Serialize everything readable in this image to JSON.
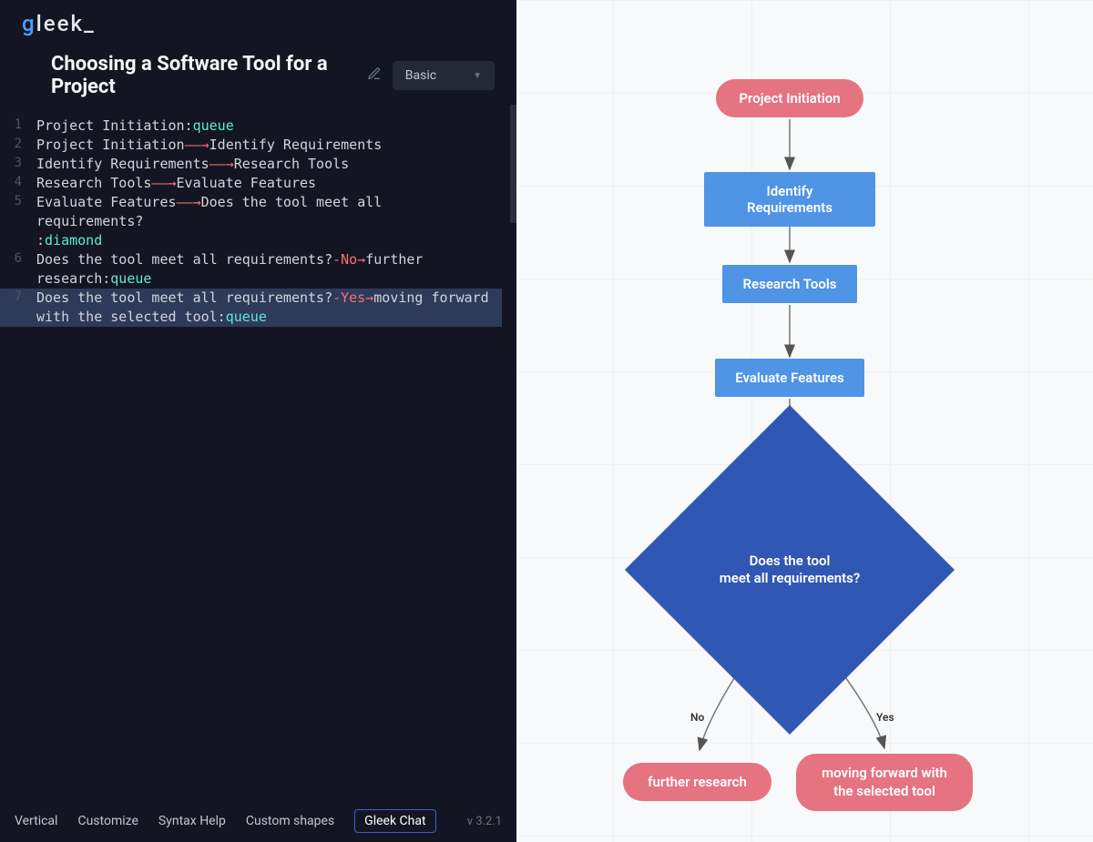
{
  "app": {
    "logo_g": "g",
    "logo_text": "leek_"
  },
  "header": {
    "title": "Choosing a Software Tool for a Project",
    "diagram_type": "Basic"
  },
  "code": {
    "lines": [
      {
        "num": "1",
        "tokens": [
          {
            "t": "text",
            "v": "Project Initiation:"
          },
          {
            "t": "queue",
            "v": "queue"
          }
        ]
      },
      {
        "num": "2",
        "tokens": [
          {
            "t": "text",
            "v": "Project Initiation"
          },
          {
            "t": "arrow",
            "v": "——→"
          },
          {
            "t": "text",
            "v": "Identify Requirements"
          }
        ]
      },
      {
        "num": "3",
        "tokens": [
          {
            "t": "text",
            "v": "Identify Requirements"
          },
          {
            "t": "arrow",
            "v": "——→"
          },
          {
            "t": "text",
            "v": "Research Tools"
          }
        ]
      },
      {
        "num": "4",
        "tokens": [
          {
            "t": "text",
            "v": "Research Tools"
          },
          {
            "t": "arrow",
            "v": "——→"
          },
          {
            "t": "text",
            "v": "Evaluate Features"
          }
        ]
      },
      {
        "num": "5",
        "tokens": [
          {
            "t": "text",
            "v": "Evaluate Features"
          },
          {
            "t": "arrow",
            "v": "——→"
          },
          {
            "t": "text",
            "v": "Does the tool meet all requirements?\n:"
          },
          {
            "t": "diamond",
            "v": "diamond"
          }
        ]
      },
      {
        "num": "6",
        "tokens": [
          {
            "t": "text",
            "v": "Does the tool meet all requirements?"
          },
          {
            "t": "branch",
            "v": "-No→"
          },
          {
            "t": "text",
            "v": "further research:"
          },
          {
            "t": "queue",
            "v": "queue"
          }
        ]
      },
      {
        "num": "7",
        "highlight": true,
        "tokens": [
          {
            "t": "text",
            "v": "Does the tool meet all requirements?"
          },
          {
            "t": "branch",
            "v": "-Yes→"
          },
          {
            "t": "text",
            "v": "moving forward with the selected tool:"
          },
          {
            "t": "queue",
            "v": "queue"
          }
        ]
      }
    ]
  },
  "bottom": {
    "vertical": "Vertical",
    "customize": "Customize",
    "syntax_help": "Syntax Help",
    "custom_shapes": "Custom shapes",
    "gleek_chat": "Gleek Chat",
    "version": "v 3.2.1"
  },
  "flow": {
    "nodes": {
      "start": "Project Initiation",
      "identify": "Identify Requirements",
      "research": "Research Tools",
      "evaluate": "Evaluate Features",
      "decision_l1": "Does the tool",
      "decision_l2": "meet all requirements?",
      "no_label": "No",
      "yes_label": "Yes",
      "further": "further research",
      "forward_l1": "moving forward with",
      "forward_l2": "the selected tool"
    }
  },
  "chart_data": {
    "type": "flowchart",
    "direction": "TB",
    "nodes": [
      {
        "id": "start",
        "label": "Project Initiation",
        "shape": "queue",
        "color": "#e57380"
      },
      {
        "id": "identify",
        "label": "Identify Requirements",
        "shape": "rect",
        "color": "#4f94e5"
      },
      {
        "id": "research",
        "label": "Research Tools",
        "shape": "rect",
        "color": "#4f94e5"
      },
      {
        "id": "evaluate",
        "label": "Evaluate Features",
        "shape": "rect",
        "color": "#4f94e5"
      },
      {
        "id": "decision",
        "label": "Does the tool meet all requirements?",
        "shape": "diamond",
        "color": "#3057b3"
      },
      {
        "id": "further",
        "label": "further research",
        "shape": "queue",
        "color": "#e57380"
      },
      {
        "id": "forward",
        "label": "moving forward with the selected tool",
        "shape": "queue",
        "color": "#e57380"
      }
    ],
    "edges": [
      {
        "from": "start",
        "to": "identify"
      },
      {
        "from": "identify",
        "to": "research"
      },
      {
        "from": "research",
        "to": "evaluate"
      },
      {
        "from": "evaluate",
        "to": "decision"
      },
      {
        "from": "decision",
        "to": "further",
        "label": "No"
      },
      {
        "from": "decision",
        "to": "forward",
        "label": "Yes"
      }
    ]
  }
}
